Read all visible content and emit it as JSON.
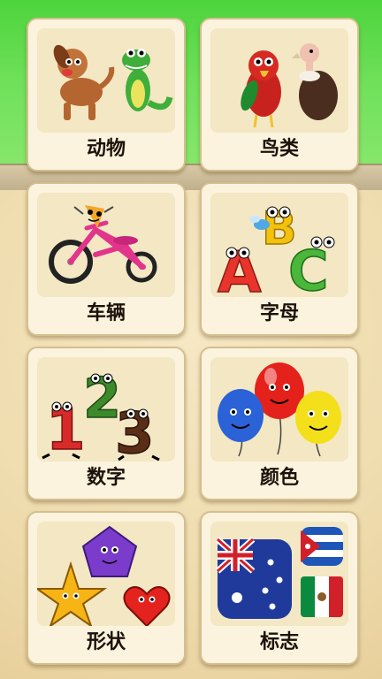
{
  "categories": [
    {
      "id": "animals",
      "label": "动物",
      "icon": "animals-dog-crocodile-icon"
    },
    {
      "id": "birds",
      "label": "鸟类",
      "icon": "birds-parrot-vulture-icon"
    },
    {
      "id": "vehicles",
      "label": "车辆",
      "icon": "vehicle-tricycle-icon"
    },
    {
      "id": "letters",
      "label": "字母",
      "icon": "letters-abc-icon"
    },
    {
      "id": "numbers",
      "label": "数字",
      "icon": "numbers-123-icon"
    },
    {
      "id": "colors",
      "label": "颜色",
      "icon": "colors-balloons-icon"
    },
    {
      "id": "shapes",
      "label": "形状",
      "icon": "shapes-star-pentagon-heart-icon"
    },
    {
      "id": "flags",
      "label": "标志",
      "icon": "flags-icon"
    }
  ],
  "colors": {
    "card_bg": "#fbf3dd",
    "card_border": "#d4bf8e",
    "label_text": "#1d120a",
    "grass": "#4dd43c"
  }
}
